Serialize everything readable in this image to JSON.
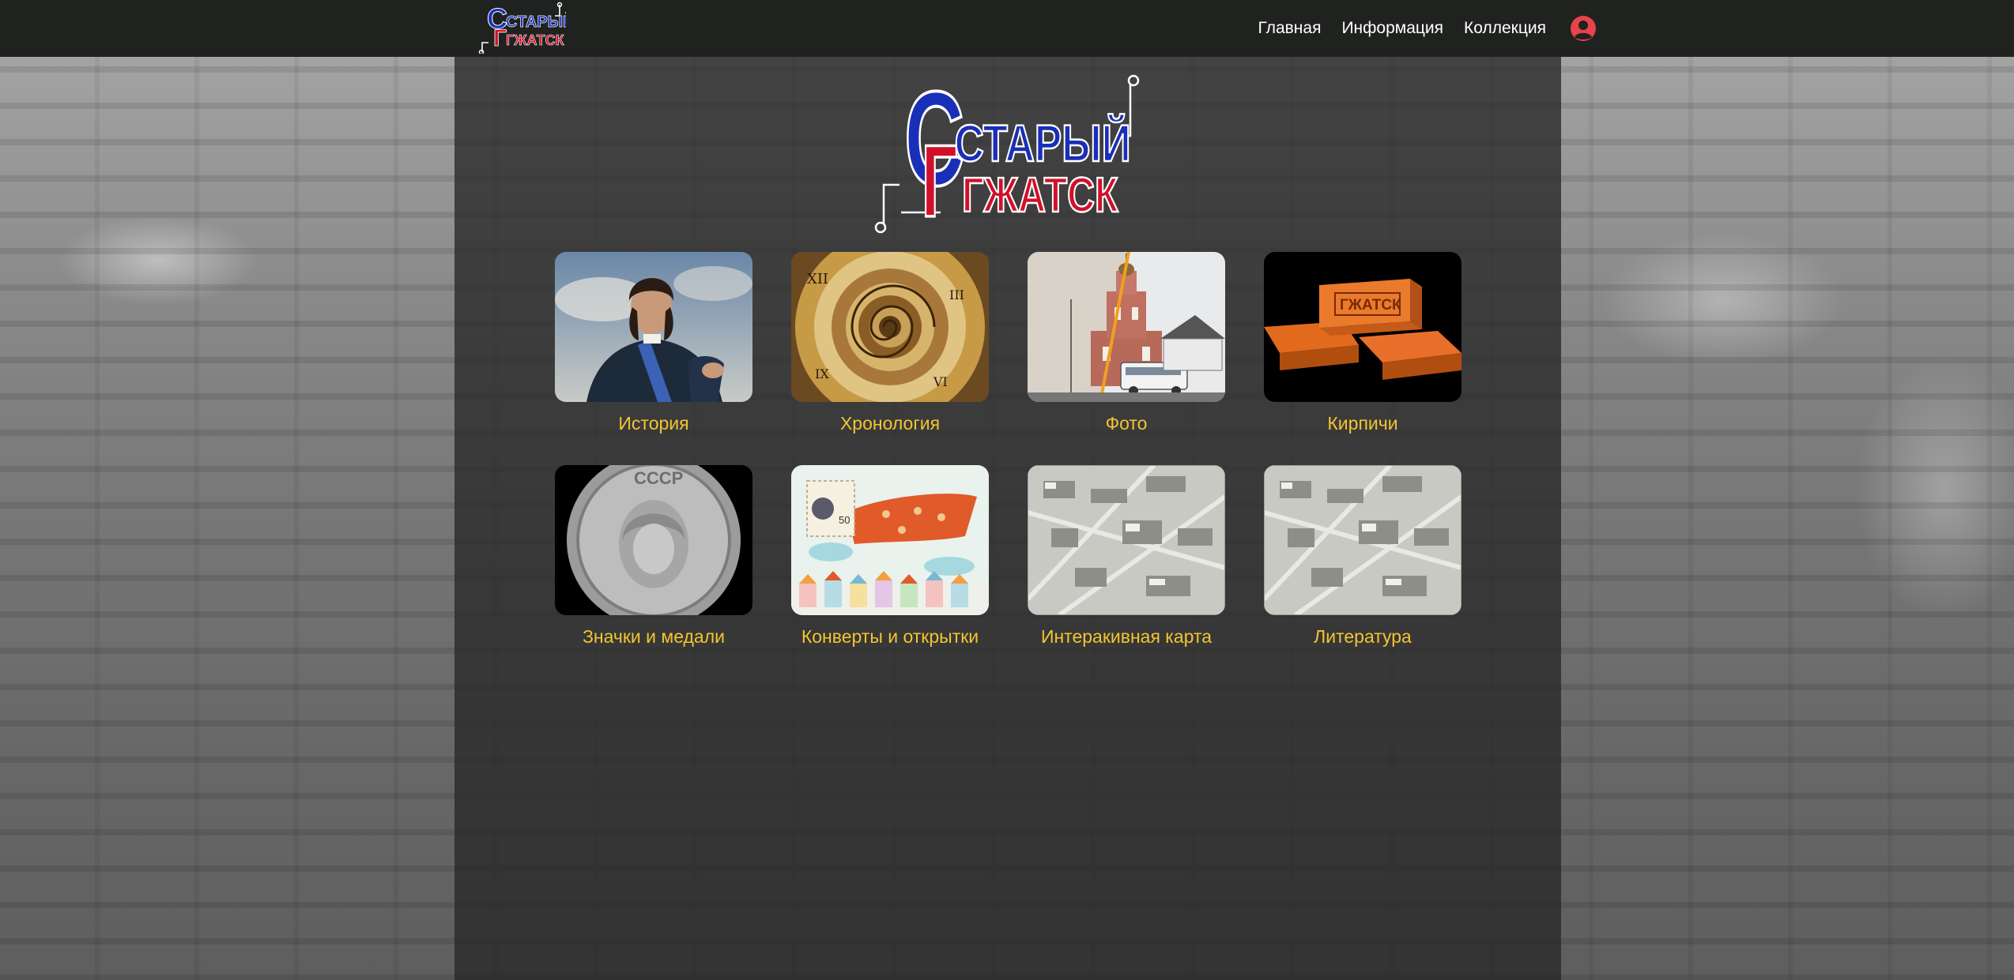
{
  "nav": {
    "links": [
      "Главная",
      "Информация",
      "Коллекция"
    ],
    "user_icon": "user-circle-icon",
    "logo_line1": "СТАРЫЙ",
    "logo_line2": "ГЖАТСК"
  },
  "hero": {
    "logo_line1": "СТАРЫЙ",
    "logo_line2": "ГЖАТСК"
  },
  "colors": {
    "accent": "#f4c430",
    "navbar": "#202220",
    "logo_blue": "#1a2fb8",
    "logo_red": "#d0102a",
    "user_icon": "#e8434b"
  },
  "cards": [
    {
      "label": "История",
      "thumb": "portrait"
    },
    {
      "label": "Хронология",
      "thumb": "spiral-clock"
    },
    {
      "label": "Фото",
      "thumb": "church-photo"
    },
    {
      "label": "Кирпичи",
      "thumb": "bricks",
      "brick_stamp": "ГЖАТСК"
    },
    {
      "label": "Значки и медали",
      "thumb": "coin",
      "coin_text": "СССР"
    },
    {
      "label": "Конверты и открытки",
      "thumb": "postcard",
      "stamp_value": "50"
    },
    {
      "label": "Интеракивная карта",
      "thumb": "aerial-map"
    },
    {
      "label": "Литература",
      "thumb": "aerial-map"
    }
  ]
}
